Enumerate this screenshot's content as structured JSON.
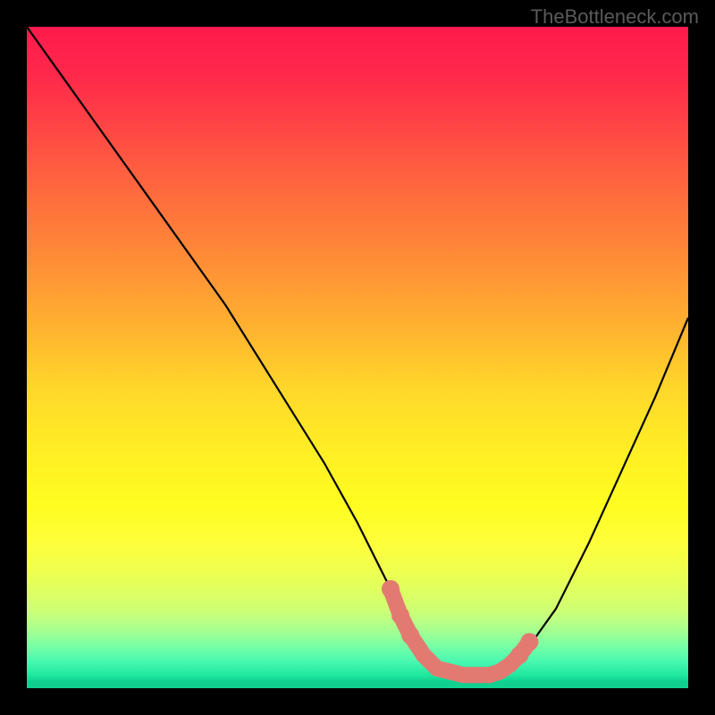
{
  "watermark": "TheBottleneck.com",
  "chart_data": {
    "type": "line",
    "title": "",
    "xlabel": "",
    "ylabel": "",
    "xlim": [
      0,
      100
    ],
    "ylim": [
      0,
      100
    ],
    "series": [
      {
        "name": "curve",
        "stroke": "#000000",
        "x": [
          0,
          5,
          10,
          15,
          20,
          25,
          30,
          35,
          40,
          45,
          50,
          55,
          58,
          60,
          62,
          65,
          68,
          70,
          72,
          75,
          80,
          85,
          90,
          95,
          100
        ],
        "y": [
          100,
          93,
          86,
          79,
          72,
          65,
          58,
          50,
          42,
          34,
          25,
          15,
          8,
          5,
          3,
          2,
          2,
          2,
          3,
          5,
          12,
          22,
          33,
          44,
          56
        ]
      }
    ],
    "highlight": {
      "name": "bottleneck-zone",
      "color": "#e27a72",
      "points": [
        {
          "x": 55,
          "y": 15
        },
        {
          "x": 56.5,
          "y": 11
        },
        {
          "x": 58,
          "y": 8
        },
        {
          "x": 60,
          "y": 5
        },
        {
          "x": 62,
          "y": 3
        },
        {
          "x": 64,
          "y": 2.5
        },
        {
          "x": 66,
          "y": 2
        },
        {
          "x": 68,
          "y": 2
        },
        {
          "x": 70,
          "y": 2
        },
        {
          "x": 71.5,
          "y": 2.5
        },
        {
          "x": 73,
          "y": 3.5
        },
        {
          "x": 74.5,
          "y": 5
        },
        {
          "x": 76,
          "y": 7
        }
      ]
    },
    "background_gradient": {
      "type": "vertical",
      "stops": [
        {
          "pos": 0.0,
          "color": "#ff1a4d"
        },
        {
          "pos": 0.5,
          "color": "#ffd82a"
        },
        {
          "pos": 0.8,
          "color": "#feff3a"
        },
        {
          "pos": 1.0,
          "color": "#10d090"
        }
      ]
    }
  }
}
